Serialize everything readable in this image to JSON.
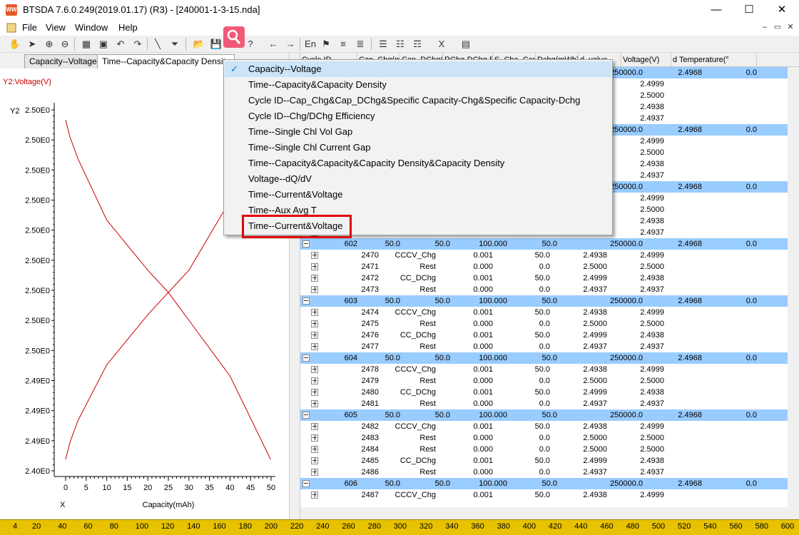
{
  "window": {
    "title": "BTSDA 7.6.0.249(2019.01.17) (R3) - [240001-1-3-15.nda]",
    "app_icon_text": "WW",
    "minimize": "—",
    "maximize": "☐",
    "close": "✕"
  },
  "menubar": {
    "items": [
      "File",
      "View",
      "Window",
      "Help"
    ],
    "mdi": [
      "–",
      "▭",
      "✕"
    ]
  },
  "tabs": [
    "Capacity--Voltage",
    "Time--Capacity&Capacity Density"
  ],
  "chart_data": {
    "type": "line",
    "y2_label": "Y2:Voltage(V)",
    "y_axis_title": "Y2",
    "x_axis_title": "X",
    "xlabel": "Capacity(mAh)",
    "x_ticks": [
      0,
      5,
      10,
      15,
      20,
      25,
      30,
      35,
      40,
      45,
      50
    ],
    "y_ticks": [
      "2.50E0",
      "2.50E0",
      "2.50E0",
      "2.50E0",
      "2.50E0",
      "2.50E0",
      "2.50E0",
      "2.50E0",
      "2.50E0",
      "2.49E0",
      "2.49E0",
      "2.49E0",
      "2.40E0"
    ],
    "xlim": [
      0,
      50
    ],
    "ylim": [
      2.4937,
      2.4999
    ],
    "series": [
      {
        "values": [
          [
            0,
            2.4999
          ],
          [
            1,
            2.4996
          ],
          [
            3,
            2.4992
          ],
          [
            10,
            2.4981
          ],
          [
            20,
            2.4972
          ],
          [
            25,
            2.4968
          ],
          [
            30,
            2.4963
          ],
          [
            40,
            2.4953
          ],
          [
            49.9,
            2.4938
          ]
        ]
      },
      {
        "values": [
          [
            0,
            2.4938
          ],
          [
            1,
            2.4941
          ],
          [
            3,
            2.4945
          ],
          [
            10,
            2.4955
          ],
          [
            20,
            2.4964
          ],
          [
            25,
            2.4968
          ],
          [
            30,
            2.4972
          ],
          [
            38,
            2.4982
          ],
          [
            38.8,
            2.4983
          ]
        ]
      }
    ],
    "line_color": "#cc0000"
  },
  "grid": {
    "headers": [
      "Cycle ID",
      "Cap_Chg(mAh)",
      "Cap_DChg(mAh)",
      "RChg-DChg Efficiency(%)",
      "Specific Cap_Chg(mAh/g)",
      "Specific Cap_DChg(mAh/g)",
      "Energy_Chg(mWh)",
      "dQ/dV_value",
      "Voltage(V)",
      "Temperature(°C)"
    ],
    "header_visible": [
      "Cycle ID",
      "Cap_Chg(mAh)",
      "Cap_DChg(mAh)",
      "RChg-DChg Efficiency",
      "S_Cha_Cap(mAh/g)",
      "Dchg(mWh)",
      "d_value",
      "Voltage(V)",
      "d Temperature(°"
    ],
    "groups": [
      {
        "cycle": "",
        "cap_chg": "",
        "cap_dchg": "",
        "eff": "",
        "scap": "",
        "energy": "250000.0",
        "volt": "2.4968",
        "temp": "0.0",
        "steps": [
          [
            "",
            "",
            "",
            "",
            "",
            "2.4999"
          ],
          [
            "",
            "",
            "",
            "",
            "",
            "2.5000"
          ],
          [
            "",
            "",
            "",
            "",
            "",
            "2.4938"
          ],
          [
            "",
            "",
            "",
            "",
            "",
            "2.4937"
          ]
        ]
      },
      {
        "cycle": "",
        "cap_chg": "",
        "cap_dchg": "",
        "eff": "",
        "scap": "",
        "energy": "250000.0",
        "volt": "2.4968",
        "temp": "0.0",
        "steps": [
          [
            "",
            "",
            "",
            "",
            "",
            "2.4999"
          ],
          [
            "",
            "",
            "",
            "",
            "",
            "2.5000"
          ],
          [
            "",
            "",
            "",
            "",
            "",
            "2.4938"
          ],
          [
            "",
            "",
            "",
            "",
            "",
            "2.4937"
          ]
        ]
      },
      {
        "cycle": "",
        "cap_chg": "",
        "cap_dchg": "",
        "eff": "",
        "scap": "",
        "energy": "250000.0",
        "volt": "2.4968",
        "temp": "0.0",
        "steps": [
          [
            "",
            "",
            "",
            "",
            "",
            "2.4999"
          ],
          [
            "",
            "",
            "",
            "",
            "",
            "2.5000"
          ],
          [
            "",
            "",
            "",
            "",
            "",
            "2.4938"
          ],
          [
            "",
            "",
            "",
            "",
            "",
            "2.4937"
          ]
        ]
      },
      {
        "cycle": "602",
        "cap_chg": "50.0",
        "cap_dchg": "50.0",
        "eff": "100.000",
        "scap": "50.0",
        "energy": "250000.0",
        "volt": "2.4968",
        "temp": "0.0",
        "steps": [
          [
            "2470",
            "CCCV_Chg",
            "0.001",
            "50.0",
            "2.4938",
            "2.4999"
          ],
          [
            "2471",
            "Rest",
            "0.000",
            "0.0",
            "2.5000",
            "2.5000"
          ],
          [
            "2472",
            "CC_DChg",
            "0.001",
            "50.0",
            "2.4999",
            "2.4938"
          ],
          [
            "2473",
            "Rest",
            "0.000",
            "0.0",
            "2.4937",
            "2.4937"
          ]
        ]
      },
      {
        "cycle": "603",
        "cap_chg": "50.0",
        "cap_dchg": "50.0",
        "eff": "100.000",
        "scap": "50.0",
        "energy": "250000.0",
        "volt": "2.4968",
        "temp": "0.0",
        "steps": [
          [
            "2474",
            "CCCV_Chg",
            "0.001",
            "50.0",
            "2.4938",
            "2.4999"
          ],
          [
            "2475",
            "Rest",
            "0.000",
            "0.0",
            "2.5000",
            "2.5000"
          ],
          [
            "2476",
            "CC_DChg",
            "0.001",
            "50.0",
            "2.4999",
            "2.4938"
          ],
          [
            "2477",
            "Rest",
            "0.000",
            "0.0",
            "2.4937",
            "2.4937"
          ]
        ]
      },
      {
        "cycle": "604",
        "cap_chg": "50.0",
        "cap_dchg": "50.0",
        "eff": "100.000",
        "scap": "50.0",
        "energy": "250000.0",
        "volt": "2.4968",
        "temp": "0.0",
        "steps": [
          [
            "2478",
            "CCCV_Chg",
            "0.001",
            "50.0",
            "2.4938",
            "2.4999"
          ],
          [
            "2479",
            "Rest",
            "0.000",
            "0.0",
            "2.5000",
            "2.5000"
          ],
          [
            "2480",
            "CC_DChg",
            "0.001",
            "50.0",
            "2.4999",
            "2.4938"
          ],
          [
            "2481",
            "Rest",
            "0.000",
            "0.0",
            "2.4937",
            "2.4937"
          ]
        ]
      },
      {
        "cycle": "605",
        "cap_chg": "50.0",
        "cap_dchg": "50.0",
        "eff": "100.000",
        "scap": "50.0",
        "energy": "250000.0",
        "volt": "2.4968",
        "temp": "0.0",
        "steps": [
          [
            "2482",
            "CCCV_Chg",
            "0.001",
            "50.0",
            "2.4938",
            "2.4999"
          ],
          [
            "2483",
            "Rest",
            "0.000",
            "0.0",
            "2.5000",
            "2.5000"
          ],
          [
            "2484",
            "Rest",
            "0.000",
            "0.0",
            "2.5000",
            "2.5000"
          ],
          [
            "2485",
            "CC_DChg",
            "0.001",
            "50.0",
            "2.4999",
            "2.4938"
          ],
          [
            "2486",
            "Rest",
            "0.000",
            "0.0",
            "2.4937",
            "2.4937"
          ]
        ]
      },
      {
        "cycle": "606",
        "cap_chg": "50.0",
        "cap_dchg": "50.0",
        "eff": "100.000",
        "scap": "50.0",
        "energy": "250000.0",
        "volt": "2.4968",
        "temp": "0.0",
        "steps": [
          [
            "2487",
            "CCCV_Chg",
            "0.001",
            "50.0",
            "2.4938",
            "2.4999"
          ]
        ]
      }
    ]
  },
  "context_menu": {
    "items": [
      {
        "label": "Capacity--Voltage",
        "checked": true
      },
      {
        "label": "Time--Capacity&Capacity Density",
        "checked": false
      },
      {
        "label": "Cycle ID--Cap_Chg&Cap_DChg&Specific Capacity-Chg&Specific Capacity-Dchg",
        "checked": false
      },
      {
        "label": "Cycle ID--Chg/DChg Efficiency",
        "checked": false
      },
      {
        "label": "Time--Single  Chl Vol Gap",
        "checked": false
      },
      {
        "label": "Time--Single  Chl Current Gap",
        "checked": false
      },
      {
        "label": "Time--Capacity&Capacity&Capacity Density&Capacity Density",
        "checked": false
      },
      {
        "label": "Voltage--dQ/dV",
        "checked": false
      },
      {
        "label": "Time--Current&Voltage",
        "checked": false
      },
      {
        "label": "Time--Aux Avg T",
        "checked": false
      },
      {
        "label": "Time--Current&Voltage",
        "checked": false,
        "highlighted": true
      }
    ],
    "check_mark": "✓"
  },
  "ruler": {
    "ticks": [
      "4",
      "20",
      "40",
      "60",
      "80",
      "100",
      "120",
      "140",
      "160",
      "180",
      "200",
      "220",
      "240",
      "260",
      "280",
      "300",
      "320",
      "340",
      "360",
      "380",
      "400",
      "420",
      "440",
      "460",
      "480",
      "500",
      "520",
      "540",
      "560",
      "580",
      "600"
    ]
  },
  "colors": {
    "cycle_row": "#99ccff",
    "ruler": "#e6c200",
    "highlight": "#e00000",
    "line": "#cc0000"
  }
}
